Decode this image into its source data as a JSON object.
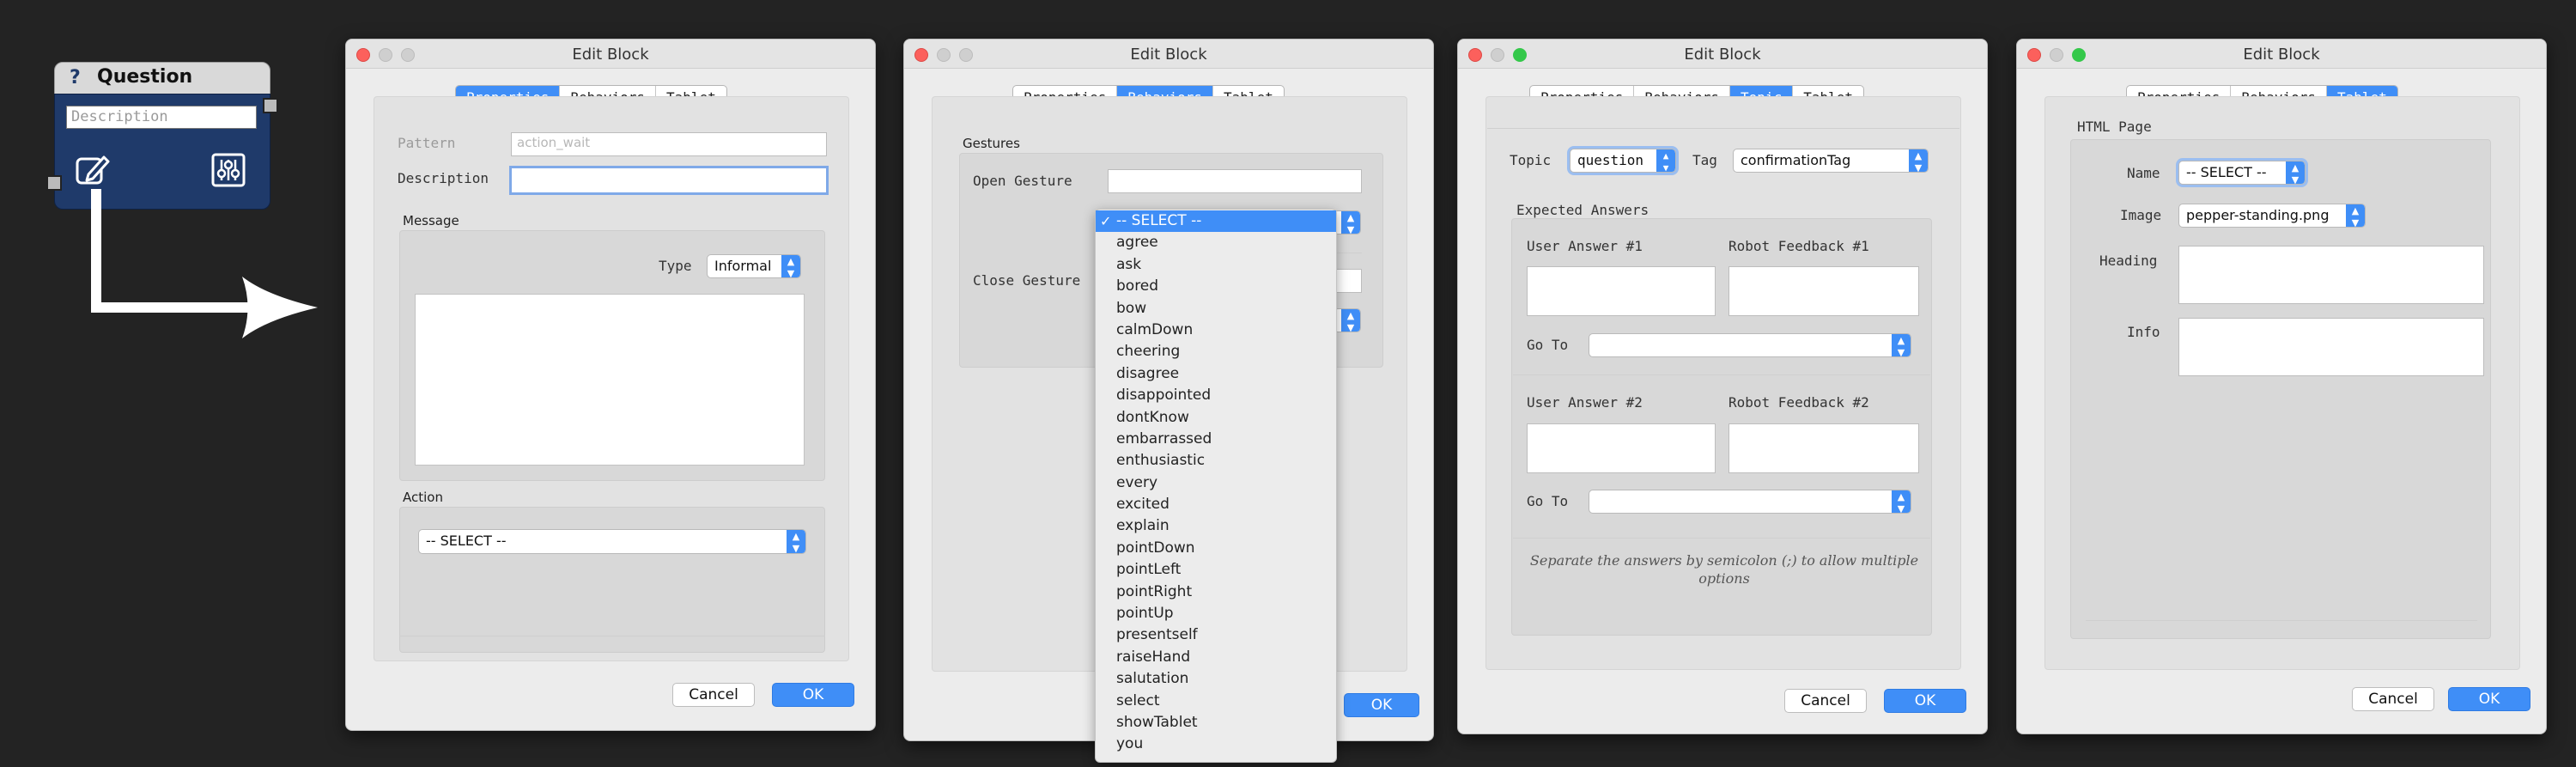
{
  "node": {
    "icon": "?",
    "title": "Question",
    "placeholder": "Description",
    "edit_icon": "edit-icon",
    "settings_icon": "sliders-icon"
  },
  "windows": {
    "w1": {
      "title": "Edit Block",
      "tabs": [
        "Properties",
        "Behaviors",
        "Tablet"
      ],
      "active_tab": "Properties",
      "pattern_label": "Pattern",
      "pattern_placeholder": "action_wait",
      "description_label": "Description",
      "message_title": "Message",
      "type_label": "Type",
      "type_value": "Informal",
      "action_title": "Action",
      "action_value": "-- SELECT --",
      "cancel": "Cancel",
      "ok": "OK"
    },
    "w2": {
      "title": "Edit Block",
      "tabs": [
        "Properties",
        "Behaviors",
        "Tablet"
      ],
      "active_tab": "Behaviors",
      "gestures_title": "Gestures",
      "open_gesture_label": "Open Gesture",
      "close_gesture_label": "Close Gesture",
      "ok": "OK",
      "dropdown": {
        "selected": "-- SELECT --",
        "options": [
          "agree",
          "ask",
          "bored",
          "bow",
          "calmDown",
          "cheering",
          "disagree",
          "disappointed",
          "dontKnow",
          "embarrassed",
          "enthusiastic",
          "every",
          "excited",
          "explain",
          "pointDown",
          "pointLeft",
          "pointRight",
          "pointUp",
          "presentself",
          "raiseHand",
          "salutation",
          "select",
          "showTablet",
          "you"
        ]
      }
    },
    "w3": {
      "title": "Edit Block",
      "tabs": [
        "Properties",
        "Behaviors",
        "Topic",
        "Tablet"
      ],
      "active_tab": "Topic",
      "topic_label": "Topic",
      "topic_value": "question",
      "tag_label": "Tag",
      "tag_value": "confirmationTag",
      "expected_title": "Expected Answers",
      "user_answer_1": "User Answer #1",
      "robot_feedback_1": "Robot Feedback #1",
      "goto_1": "Go To",
      "user_answer_2": "User Answer #2",
      "robot_feedback_2": "Robot Feedback #2",
      "goto_2": "Go To",
      "note": "Separate the answers by semicolon (;) to allow multiple options",
      "cancel": "Cancel",
      "ok": "OK"
    },
    "w4": {
      "title": "Edit Block",
      "tabs": [
        "Properties",
        "Behaviors",
        "Tablet"
      ],
      "active_tab": "Tablet",
      "html_page_title": "HTML Page",
      "name_label": "Name",
      "name_value": "-- SELECT --",
      "image_label": "Image",
      "image_value": "pepper-standing.png",
      "heading_label": "Heading",
      "info_label": "Info",
      "cancel": "Cancel",
      "ok": "OK"
    }
  },
  "colors": {
    "background": "#232323",
    "accent": "#3f8ef7",
    "node_header": "#d9d9d9",
    "node_body": "#1f3a6a"
  }
}
